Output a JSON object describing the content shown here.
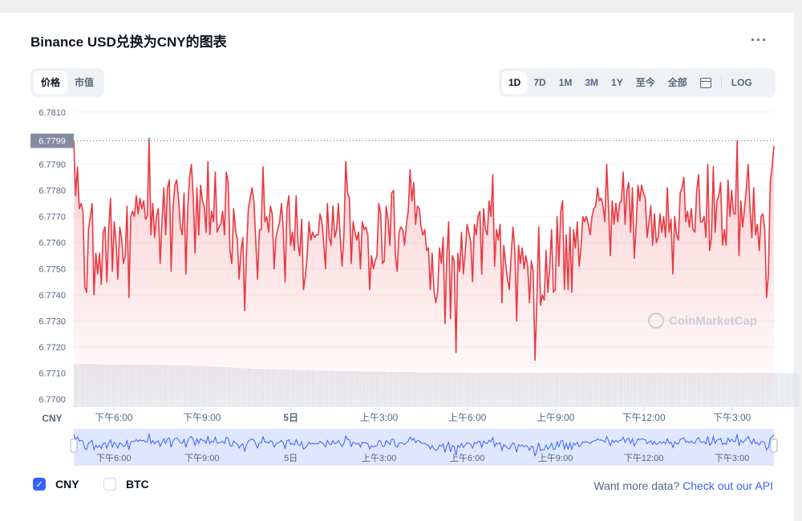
{
  "page": {
    "title": "Binance USD兑换为CNY的图表",
    "more": "···"
  },
  "metric_tabs": [
    {
      "label": "价格",
      "active": true
    },
    {
      "label": "市值",
      "active": false
    }
  ],
  "range_tabs": [
    {
      "label": "1D",
      "active": true
    },
    {
      "label": "7D",
      "active": false
    },
    {
      "label": "1M",
      "active": false
    },
    {
      "label": "3M",
      "active": false
    },
    {
      "label": "1Y",
      "active": false
    },
    {
      "label": "至今",
      "active": false
    },
    {
      "label": "全部",
      "active": false
    }
  ],
  "calendar_icon": "calendar-icon",
  "log_label": "LOG",
  "legend": [
    {
      "label": "CNY",
      "checked": true
    },
    {
      "label": "BTC",
      "checked": false
    }
  ],
  "footer": {
    "prefix": "Want more data?",
    "link": "Check out our API"
  },
  "watermark": "CoinMarketCap",
  "colors": {
    "line": "#ea3943",
    "up": "#16c784",
    "volume": "#e2e5ea",
    "nav_line": "#3861fb",
    "nav_fill": "#dfe6ff"
  },
  "chart_data": {
    "type": "line",
    "xlabel": "CNY",
    "ylim": [
      6.7697,
      6.7813
    ],
    "y_ticks": [
      "6.7810",
      "6.7800",
      "6.7790",
      "6.7780",
      "6.7770",
      "6.7760",
      "6.7750",
      "6.7740",
      "6.7730",
      "6.7720",
      "6.7710",
      "6.7700"
    ],
    "current_price": "6.7799",
    "x_ticks": [
      "下午6:00",
      "下午9:00",
      "5日",
      "上午3:00",
      "上午6:00",
      "上午9:00",
      "下午12:00",
      "下午3:00"
    ],
    "series": [
      {
        "values": [
          6.7799,
          6.7778,
          6.7789,
          6.7773,
          6.7775,
          6.7772,
          6.7743,
          6.7741,
          6.7765,
          6.777,
          6.7775,
          6.774,
          6.7756,
          6.7748,
          6.7756,
          6.7744,
          6.7764,
          6.7766,
          6.7745,
          6.7765,
          6.7777,
          6.7749,
          6.7768,
          6.776,
          6.7746,
          6.7766,
          6.7762,
          6.7752,
          6.7755,
          6.7774,
          6.7739,
          6.777,
          6.7772,
          6.777,
          6.7778,
          6.7771,
          6.7777,
          6.7773,
          6.7776,
          6.7769,
          6.777,
          6.78,
          6.7763,
          6.7775,
          6.7762,
          6.777,
          6.7773,
          6.7752,
          6.7768,
          6.7781,
          6.7763,
          6.7781,
          6.7784,
          6.7749,
          6.7773,
          6.7782,
          6.7784,
          6.7777,
          6.7766,
          6.7763,
          6.7779,
          6.7748,
          6.7773,
          6.7785,
          6.779,
          6.7778,
          6.7756,
          6.7781,
          6.7763,
          6.7782,
          6.7776,
          6.7774,
          6.7764,
          6.7791,
          6.7763,
          6.7772,
          6.7768,
          6.7787,
          6.7764,
          6.7766,
          6.7767,
          6.7772,
          6.7763,
          6.7787,
          6.7783,
          6.7757,
          6.7752,
          6.7773,
          6.7765,
          6.7761,
          6.7746,
          6.7757,
          6.7762,
          6.7734,
          6.7757,
          6.7773,
          6.7777,
          6.7781,
          6.7776,
          6.7761,
          6.7746,
          6.7765,
          6.7765,
          6.7789,
          6.7768,
          6.777,
          6.7764,
          6.7774,
          6.7771,
          6.775,
          6.7762,
          6.7765,
          6.7768,
          6.7775,
          6.7765,
          6.7745,
          6.7773,
          6.7778,
          6.7759,
          6.7764,
          6.7757,
          6.7778,
          6.776,
          6.7755,
          6.7769,
          6.7742,
          6.7747,
          6.7755,
          6.7768,
          6.7761,
          6.7764,
          6.7762,
          6.7763,
          6.7763,
          6.7771,
          6.7768,
          6.776,
          6.775,
          6.7775,
          6.7762,
          6.7759,
          6.7774,
          6.7762,
          6.7765,
          6.7775,
          6.7762,
          6.7751,
          6.7763,
          6.7791,
          6.7779,
          6.7777,
          6.7752,
          6.7768,
          6.7764,
          6.7761,
          6.7764,
          6.775,
          6.7768,
          6.7765,
          6.7766,
          6.7763,
          6.7742,
          6.7755,
          6.775,
          6.7753,
          6.7755,
          6.7775,
          6.7771,
          6.7752,
          6.7753,
          6.7774,
          6.7769,
          6.7759,
          6.7779,
          6.778,
          6.7755,
          6.7749,
          6.7764,
          6.7766,
          6.7765,
          6.7759,
          6.7767,
          6.7772,
          6.7788,
          6.7776,
          6.7783,
          6.7767,
          6.7774,
          6.7773,
          6.7766,
          6.7763,
          6.7765,
          6.7757,
          6.7758,
          6.7742,
          6.7756,
          6.7742,
          6.7737,
          6.7741,
          6.7758,
          6.7752,
          6.7762,
          6.7729,
          6.7755,
          6.7768,
          6.7731,
          6.7755,
          6.7753,
          6.7718,
          6.7756,
          6.7749,
          6.7764,
          6.7748,
          6.7756,
          6.7767,
          6.7764,
          6.776,
          6.7745,
          6.7767,
          6.7763,
          6.777,
          6.7772,
          6.7748,
          6.7773,
          6.7765,
          6.7763,
          6.7776,
          6.777,
          6.7786,
          6.7751,
          6.7765,
          6.7761,
          6.7767,
          6.7737,
          6.7759,
          6.7752,
          6.7746,
          6.7742,
          6.7755,
          6.7766,
          6.7757,
          6.773,
          6.7759,
          6.7752,
          6.7758,
          6.775,
          6.7755,
          6.7751,
          6.7737,
          6.7753,
          6.7749,
          6.7715,
          6.7738,
          6.7766,
          6.7736,
          6.774,
          6.7738,
          6.7757,
          6.7741,
          6.7751,
          6.7765,
          6.7741,
          6.7742,
          6.777,
          6.7751,
          6.7772,
          6.7776,
          6.7742,
          6.7763,
          6.7742,
          6.7766,
          6.7741,
          6.7765,
          6.7758,
          6.7768,
          6.7751,
          6.7758,
          6.777,
          6.7768,
          6.777,
          6.7767,
          6.7763,
          6.777,
          6.7773,
          6.7774,
          6.7781,
          6.7776,
          6.7777,
          6.7774,
          6.7768,
          6.779,
          6.7773,
          6.7755,
          6.7776,
          6.7767,
          6.7775,
          6.7768,
          6.7775,
          6.7776,
          6.7787,
          6.7767,
          6.778,
          6.7783,
          6.7764,
          6.7781,
          6.7754,
          6.7766,
          6.7782,
          6.7776,
          6.7782,
          6.7779,
          6.7777,
          6.7762,
          6.7768,
          6.7774,
          6.7759,
          6.7771,
          6.776,
          6.7762,
          6.7771,
          6.7764,
          6.777,
          6.7762,
          6.7781,
          6.7764,
          6.7769,
          6.7748,
          6.777,
          6.7763,
          6.7761,
          6.7779,
          6.7781,
          6.7785,
          6.7768,
          6.7772,
          6.7766,
          6.7773,
          6.7765,
          6.7764,
          6.778,
          6.7786,
          6.7768,
          6.7768,
          6.777,
          6.7762,
          6.779,
          6.7757,
          6.7762,
          6.7789,
          6.7764,
          6.7776,
          6.7778,
          6.7783,
          6.7759,
          6.7765,
          6.7759,
          6.7784,
          6.777,
          6.778,
          6.7771,
          6.7771,
          6.7799,
          6.7755,
          6.7776,
          6.7766,
          6.7773,
          6.7781,
          6.779,
          6.7773,
          6.7762,
          6.7781,
          6.7763,
          6.7767,
          6.7757,
          6.777,
          6.7771,
          6.7765,
          6.7739,
          6.7748,
          6.7783,
          6.7789,
          6.7797
        ],
        "volume": [
          0.9,
          0.9,
          0.9,
          0.9,
          0.9,
          0.9,
          0.9,
          0.9,
          0.9,
          0.9,
          0.9,
          0.9,
          0.9,
          0.89,
          0.89,
          0.89,
          0.89,
          0.89,
          0.89,
          0.89,
          0.89,
          0.89,
          0.89,
          0.89,
          0.89,
          0.89,
          0.89,
          0.89,
          0.89,
          0.89,
          0.89,
          0.89,
          0.89,
          0.89,
          0.89,
          0.88,
          0.88,
          0.88,
          0.88,
          0.88,
          0.88,
          0.88,
          0.88,
          0.88,
          0.88,
          0.88,
          0.88,
          0.88,
          0.88,
          0.88,
          0.88,
          0.88,
          0.88,
          0.87,
          0.87,
          0.87,
          0.87,
          0.87,
          0.87,
          0.87,
          0.87,
          0.87,
          0.87,
          0.87,
          0.86,
          0.86,
          0.86,
          0.86,
          0.86,
          0.86,
          0.86,
          0.85,
          0.85,
          0.85,
          0.85,
          0.85,
          0.84,
          0.84,
          0.84,
          0.84,
          0.84,
          0.84,
          0.83,
          0.83,
          0.83,
          0.83,
          0.83,
          0.82,
          0.82,
          0.82,
          0.82,
          0.82,
          0.81,
          0.81,
          0.81,
          0.81,
          0.81,
          0.8,
          0.8,
          0.8,
          0.8,
          0.8,
          0.8,
          0.79,
          0.79,
          0.79,
          0.79,
          0.79,
          0.79,
          0.79,
          0.79,
          0.78,
          0.78,
          0.78,
          0.78,
          0.78,
          0.78,
          0.78,
          0.78,
          0.78,
          0.78,
          0.77,
          0.77,
          0.77,
          0.77,
          0.77,
          0.77,
          0.77,
          0.77,
          0.77,
          0.77,
          0.77,
          0.76,
          0.76,
          0.76,
          0.76,
          0.76,
          0.76,
          0.76,
          0.76,
          0.76,
          0.76,
          0.76,
          0.76,
          0.75,
          0.75,
          0.75,
          0.75,
          0.75,
          0.75,
          0.75,
          0.75,
          0.75,
          0.75,
          0.75,
          0.75,
          0.74,
          0.74,
          0.74,
          0.74,
          0.74,
          0.74,
          0.74,
          0.74,
          0.74,
          0.74,
          0.74,
          0.74,
          0.74,
          0.74,
          0.73,
          0.73,
          0.73,
          0.73,
          0.73,
          0.73,
          0.73,
          0.73,
          0.73,
          0.73,
          0.73,
          0.73,
          0.73,
          0.73,
          0.73,
          0.73,
          0.72,
          0.72,
          0.72,
          0.72,
          0.72,
          0.72,
          0.72,
          0.72,
          0.72,
          0.72,
          0.72,
          0.72,
          0.72,
          0.72,
          0.72,
          0.72,
          0.72,
          0.72,
          0.72,
          0.72,
          0.72,
          0.72,
          0.72,
          0.72,
          0.72,
          0.72,
          0.71,
          0.71,
          0.71,
          0.71,
          0.71,
          0.71,
          0.71,
          0.71,
          0.71,
          0.71,
          0.71,
          0.71,
          0.71,
          0.71,
          0.71,
          0.71,
          0.71,
          0.71,
          0.71,
          0.71,
          0.71,
          0.71,
          0.71,
          0.71,
          0.71,
          0.71,
          0.71,
          0.71,
          0.71,
          0.71,
          0.71,
          0.71,
          0.71,
          0.71,
          0.71,
          0.71,
          0.71,
          0.71,
          0.71,
          0.71,
          0.71,
          0.71,
          0.71,
          0.71,
          0.71,
          0.71,
          0.71,
          0.71,
          0.71,
          0.71,
          0.71,
          0.71,
          0.71,
          0.71,
          0.71,
          0.71,
          0.71,
          0.71,
          0.71,
          0.71,
          0.71,
          0.71,
          0.71,
          0.71,
          0.71,
          0.71,
          0.71,
          0.71,
          0.71,
          0.71,
          0.71,
          0.71,
          0.71,
          0.71,
          0.71,
          0.71,
          0.71,
          0.71,
          0.71,
          0.71,
          0.71,
          0.71,
          0.71,
          0.71,
          0.71,
          0.71,
          0.71,
          0.71,
          0.71,
          0.71,
          0.71,
          0.71,
          0.71,
          0.71,
          0.71,
          0.71,
          0.71,
          0.71,
          0.71,
          0.71,
          0.71,
          0.71,
          0.71,
          0.71,
          0.71,
          0.71,
          0.71,
          0.71,
          0.71,
          0.71,
          0.71,
          0.71,
          0.71,
          0.71,
          0.71,
          0.71,
          0.71,
          0.71,
          0.71,
          0.71,
          0.71,
          0.71,
          0.71,
          0.71,
          0.71,
          0.71,
          0.71,
          0.71,
          0.71,
          0.71,
          0.71,
          0.71,
          0.71,
          0.71,
          0.71,
          0.71,
          0.71,
          0.71,
          0.71,
          0.71,
          0.71,
          0.71,
          0.71,
          0.71,
          0.71,
          0.71,
          0.71,
          0.71,
          0.71,
          0.71,
          0.71,
          0.71,
          0.71,
          0.71,
          0.71,
          0.71,
          0.71,
          0.71,
          0.71,
          0.71,
          0.71,
          0.71,
          0.71,
          0.71,
          0.71,
          0.71,
          0.71,
          0.71,
          0.71,
          0.71,
          0.71,
          0.71,
          0.71,
          0.71,
          0.71,
          0.71,
          0.71,
          0.71,
          0.71,
          0.71,
          0.71,
          0.71,
          0.71,
          0.71
        ]
      }
    ]
  }
}
